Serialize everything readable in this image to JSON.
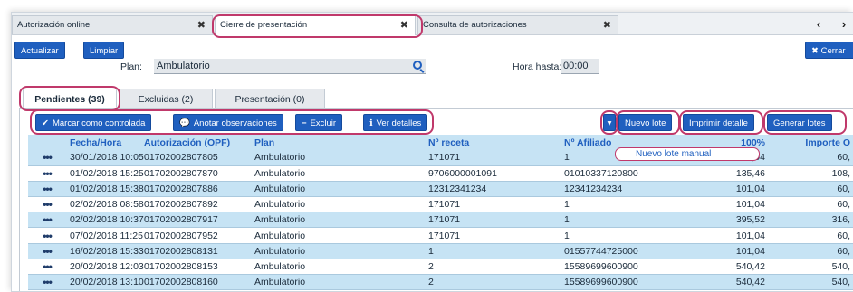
{
  "window_tabs": [
    {
      "label": "Autorización online",
      "close": "✖"
    },
    {
      "label": "Cierre de presentación",
      "close": "✖"
    },
    {
      "label": "Consulta de autorizaciones",
      "close": "✖"
    }
  ],
  "nav": {
    "prev": "‹",
    "next": "›"
  },
  "toolbar": {
    "refresh_label": "Actualizar",
    "clear_label": "Limpiar",
    "close_label": "✖ Cerrar"
  },
  "filters": {
    "plan_label": "Plan:",
    "plan_value": "Ambulatorio",
    "time_label": "Hora hasta:",
    "time_value": "00:00"
  },
  "sub_tabs": [
    {
      "label": "Pendientes (39)"
    },
    {
      "label": "Excluidas (2)"
    },
    {
      "label": "Presentación (0)"
    }
  ],
  "actions": {
    "mark_controlled": "Marcar como controlada",
    "annotate": "Anotar observaciones",
    "exclude": "Excluir",
    "details": "Ver detalles",
    "dropdown_toggle": "▾",
    "new_batch": "Nuevo lote",
    "print_detail": "Imprimir detalle",
    "generate_batches": "Generar lotes",
    "new_manual_batch": "Nuevo lote manual"
  },
  "table": {
    "columns": [
      "",
      "Fecha/Hora",
      "Autorización (OPF)",
      "Plan",
      "Nº receta",
      "Nº Afiliado",
      "100%",
      "Importe O"
    ],
    "rows": [
      [
        "•••",
        "30/01/2018 10:05",
        "01702002807805",
        "Ambulatorio",
        "171071",
        "1",
        "101,04",
        "60,"
      ],
      [
        "•••",
        "01/02/2018 15:25",
        "01702002807870",
        "Ambulatorio",
        "9706000001091",
        "01010337120800",
        "135,46",
        "108,"
      ],
      [
        "•••",
        "01/02/2018 15:38",
        "01702002807886",
        "Ambulatorio",
        "12312341234",
        "12341234234",
        "101,04",
        "60,"
      ],
      [
        "•••",
        "02/02/2018 08:58",
        "01702002807892",
        "Ambulatorio",
        "171071",
        "1",
        "101,04",
        "60,"
      ],
      [
        "•••",
        "02/02/2018 10:37",
        "01702002807917",
        "Ambulatorio",
        "171071",
        "1",
        "395,52",
        "316,"
      ],
      [
        "•••",
        "07/02/2018 11:25",
        "01702002807952",
        "Ambulatorio",
        "171071",
        "1",
        "101,04",
        "60,"
      ],
      [
        "•••",
        "16/02/2018 15:33",
        "01702002808131",
        "Ambulatorio",
        "1",
        "01557744725000",
        "101,04",
        "60,"
      ],
      [
        "•••",
        "20/02/2018 12:03",
        "01702002808153",
        "Ambulatorio",
        "2",
        "15589699600900",
        "540,42",
        "540,"
      ],
      [
        "•••",
        "20/02/2018 13:10",
        "01702002808160",
        "Ambulatorio",
        "2",
        "15589699600900",
        "540,42",
        "540,"
      ]
    ]
  },
  "colors": {
    "accent": "#1f5fbf",
    "row_alt": "#c6e3f4",
    "highlight": "#c0396b"
  }
}
